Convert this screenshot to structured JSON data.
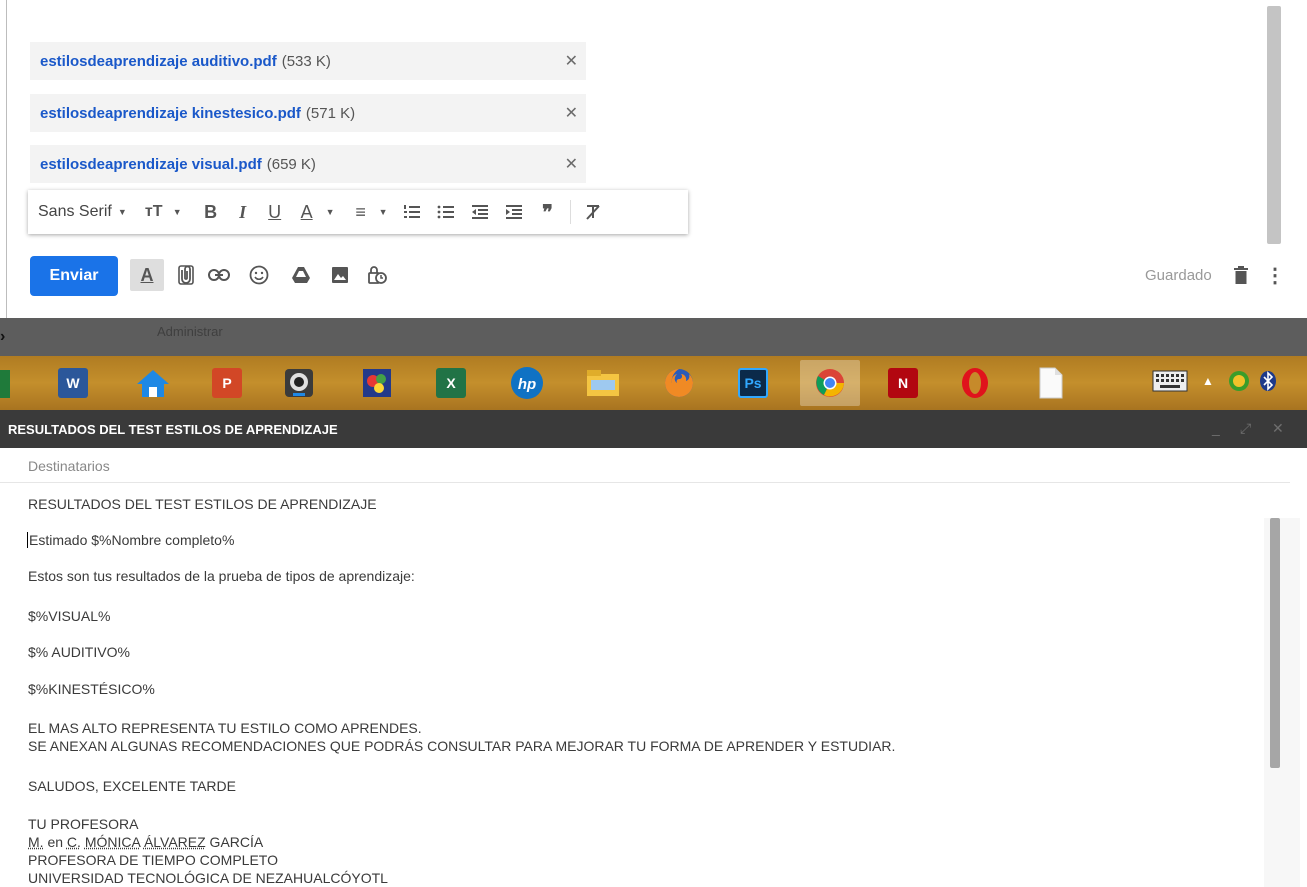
{
  "attachments": [
    {
      "name": "estilosdeaprendizaje auditivo.pdf",
      "size": "(533 K)"
    },
    {
      "name": "estilosdeaprendizaje kinestesico.pdf",
      "size": "(571 K)"
    },
    {
      "name": "estilosdeaprendizaje visual.pdf",
      "size": "(659 K)"
    }
  ],
  "format_bar": {
    "font": "Sans Serif",
    "tools": [
      "text-size-icon",
      "bold-icon",
      "italic-icon",
      "underline-icon",
      "text-color-icon",
      "align-icon",
      "numbered-list-icon",
      "bulleted-list-icon",
      "indent-less-icon",
      "indent-more-icon",
      "quote-icon",
      "remove-formatting-icon"
    ]
  },
  "send_row": {
    "send_label": "Enviar",
    "saved_label": "Guardado"
  },
  "admin_band": {
    "label": "Administrar"
  },
  "taskbar": {
    "apps": [
      "word-icon",
      "home-icon",
      "powerpoint-icon",
      "webcam-icon",
      "paint-icon",
      "excel-icon",
      "hp-icon",
      "file-explorer-icon",
      "firefox-icon",
      "photoshop-icon",
      "chrome-icon",
      "netflix-icon",
      "opera-icon",
      "document-icon"
    ],
    "tray": [
      "keyboard-icon",
      "up-arrow-icon",
      "refresh-icon",
      "bluetooth-icon"
    ]
  },
  "mail": {
    "title": "RESULTADOS DEL TEST ESTILOS DE APRENDIZAJE",
    "recipients": "Destinatarios",
    "subject": "RESULTADOS DEL TEST ESTILOS DE APRENDIZAJE",
    "greeting": "Estimado $%Nombre completo%",
    "intro": "Estos son tus resultados de la prueba de tipos de aprendizaje:",
    "visual": "$%VISUAL%",
    "auditivo": "$% AUDITIVO%",
    "kinestesico": "$%KINESTÉSICO%",
    "line1": "EL MAS ALTO REPRESENTA  TU ESTILO COMO APRENDES.",
    "line2": "SE ANEXAN ALGUNAS RECOMENDACIONES QUE PODRÁS CONSULTAR PARA MEJORAR TU FORMA DE APRENDER Y ESTUDIAR.",
    "farewell": "SALUDOS, EXCELENTE TARDE",
    "sig1": "TU PROFESORA",
    "sig2_a": "M.",
    "sig2_b": " en ",
    "sig2_c": "C.",
    "sig2_d": " ",
    "sig2_e": "MÓNICA",
    "sig2_f": " ",
    "sig2_g": "ÁLVAREZ",
    "sig2_h": "  GARCÍA",
    "sig3": "PROFESORA DE TIEMPO COMPLETO",
    "sig4": "UNIVERSIDAD TECNOLÓGICA DE NEZAHUALCÓYOTL"
  },
  "colors": {
    "accent": "#1a73e8",
    "link": "#1a58c9",
    "header": "#3a3a3a",
    "taskbar": "#c48f2c"
  }
}
